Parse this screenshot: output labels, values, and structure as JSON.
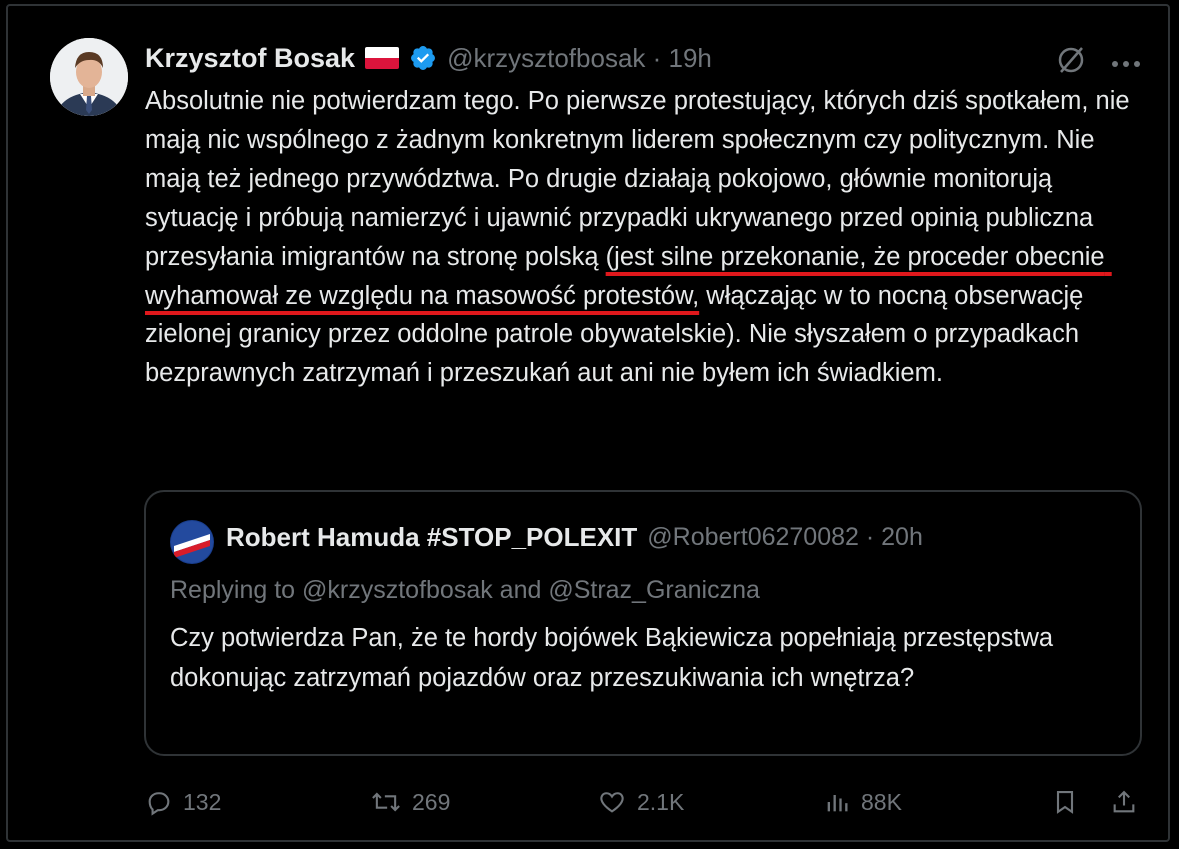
{
  "author": {
    "name": "Krzysztof Bosak",
    "handle_time": "@krzysztofbosak · 19h"
  },
  "tweet": {
    "text_before": "Absolutnie nie potwierdzam tego. Po pierwsze protestujący, których dziś spotkałem, nie mają nic wspólnego z żadnym konkretnym liderem społecznym czy politycznym. Nie mają też jednego przywództwa. Po drugie działają pokojowo, głównie monitorują sytuację i próbują namierzyć i ujawnić przypadki ukrywanego przed opinią publiczna przesyłania imigrantów na stronę polską ",
    "text_highlighted": "(jest silne przekonanie, że proceder obecnie wyhamował ze względu na masowość protestów,",
    "text_after": " włączając w to nocną obserwację zielonej granicy przez oddolne patrole obywatelskie). Nie słyszałem o przypadkach bezprawnych zatrzymań i przeszukań aut ani nie byłem ich świadkiem."
  },
  "quoted": {
    "name": "Robert Hamuda #STOP_POLEXIT",
    "handle_time": "@Robert06270082 · 20h",
    "replying": "Replying to @krzysztofbosak and @Straz_Graniczna",
    "text": "Czy potwierdza Pan, że te hordy bojówek Bąkiewicza popełniają przestępstwa dokonując zatrzymań pojazdów oraz przeszukiwania ich wnętrza?"
  },
  "actions": {
    "replies": "132",
    "reposts": "269",
    "likes": "2.1K",
    "views": "88K"
  },
  "colors": {
    "background": "#000000",
    "text": "#e7e9ea",
    "secondary": "#71767b",
    "border": "#2f3336",
    "verified": "#1d9bf0",
    "underline": "#e0181c"
  }
}
